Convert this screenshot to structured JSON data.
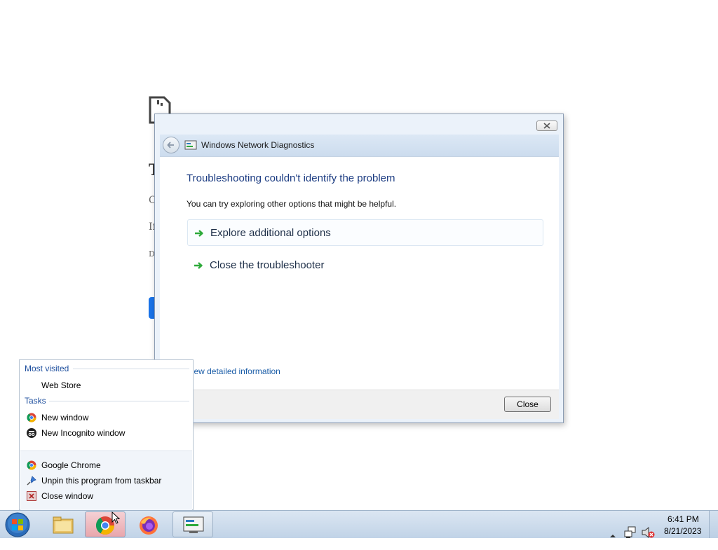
{
  "background_page": {
    "heading_fragment": "T",
    "line1_fragment": "C",
    "line2_fragment": "If",
    "line3_fragment": "D"
  },
  "dialog": {
    "title": "Windows Network Diagnostics",
    "heading": "Troubleshooting couldn't identify the problem",
    "subtext": "You can try exploring other options that might be helpful.",
    "options": [
      {
        "label": "Explore additional options",
        "icon": "green-arrow-icon"
      },
      {
        "label": "Close the troubleshooter",
        "icon": "green-arrow-icon"
      }
    ],
    "detail_link": "View detailed information",
    "close_button": "Close",
    "colors": {
      "heading": "#1c3c82",
      "arrow": "#2eaa3a",
      "link": "#1c5ea8"
    }
  },
  "jumplist": {
    "most_visited_header": "Most visited",
    "most_visited": [
      {
        "label": "Web Store"
      }
    ],
    "tasks_header": "Tasks",
    "tasks": [
      {
        "label": "New window",
        "icon": "chrome-icon"
      },
      {
        "label": "New Incognito window",
        "icon": "incognito-icon"
      }
    ],
    "bottom": [
      {
        "label": "Google Chrome",
        "icon": "chrome-icon"
      },
      {
        "label": "Unpin this program from taskbar",
        "icon": "unpin-icon"
      },
      {
        "label": "Close window",
        "icon": "close-window-icon"
      }
    ]
  },
  "taskbar": {
    "items": [
      {
        "name": "start-button",
        "icon": "windows-orb-icon"
      },
      {
        "name": "explorer",
        "icon": "folder-icon"
      },
      {
        "name": "chrome",
        "icon": "chrome-icon",
        "state": "active"
      },
      {
        "name": "firefox",
        "icon": "firefox-icon"
      },
      {
        "name": "network-diagnostics",
        "icon": "network-diagnostics-icon",
        "state": "open"
      }
    ],
    "clock": {
      "time": "6:41 PM",
      "date": "8/21/2023"
    },
    "tray_icons": [
      "show-hidden-icons-arrow",
      "network-icon",
      "volume-muted-icon"
    ]
  }
}
